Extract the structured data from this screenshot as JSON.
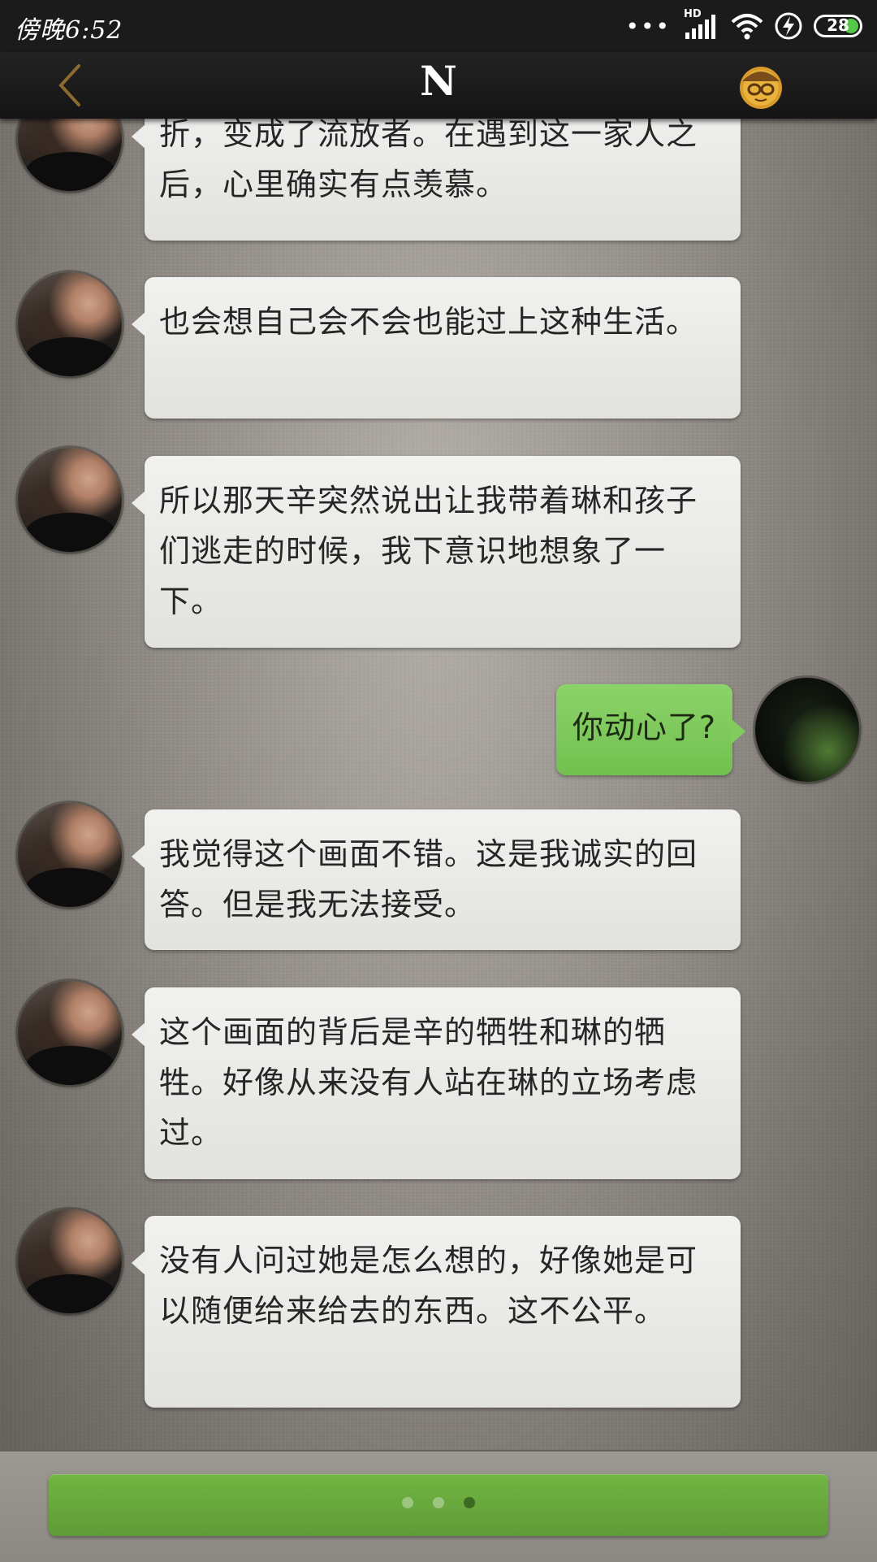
{
  "status_bar": {
    "time": "傍晚6:52",
    "network": "HD",
    "battery": "28"
  },
  "header": {
    "title": "N",
    "back_icon": "chevron-left-icon",
    "menu_avatar_icon": "yellow-character-avatar-icon"
  },
  "messages": [
    {
      "sender": "other",
      "text": "折，变成了流放者。在遇到这一家人之后，心里确实有点羡慕。"
    },
    {
      "sender": "other",
      "text": "也会想自己会不会也能过上这种生活。"
    },
    {
      "sender": "other",
      "text": "所以那天辛突然说出让我带着琳和孩子们逃走的时候，我下意识地想象了一下。"
    },
    {
      "sender": "me",
      "text": "你动心了?"
    },
    {
      "sender": "other",
      "text": "我觉得这个画面不错。这是我诚实的回答。但是我无法接受。"
    },
    {
      "sender": "other",
      "text": "这个画面的背后是辛的牺牲和琳的牺牲。好像从来没有人站在琳的立场考虑过。"
    },
    {
      "sender": "other",
      "text": "没有人问过她是怎么想的，好像她是可以随便给来给去的东西。这不公平。"
    }
  ],
  "bottom": {
    "loading_indicator": "three-dots",
    "accent_color": "#6aab3d"
  }
}
